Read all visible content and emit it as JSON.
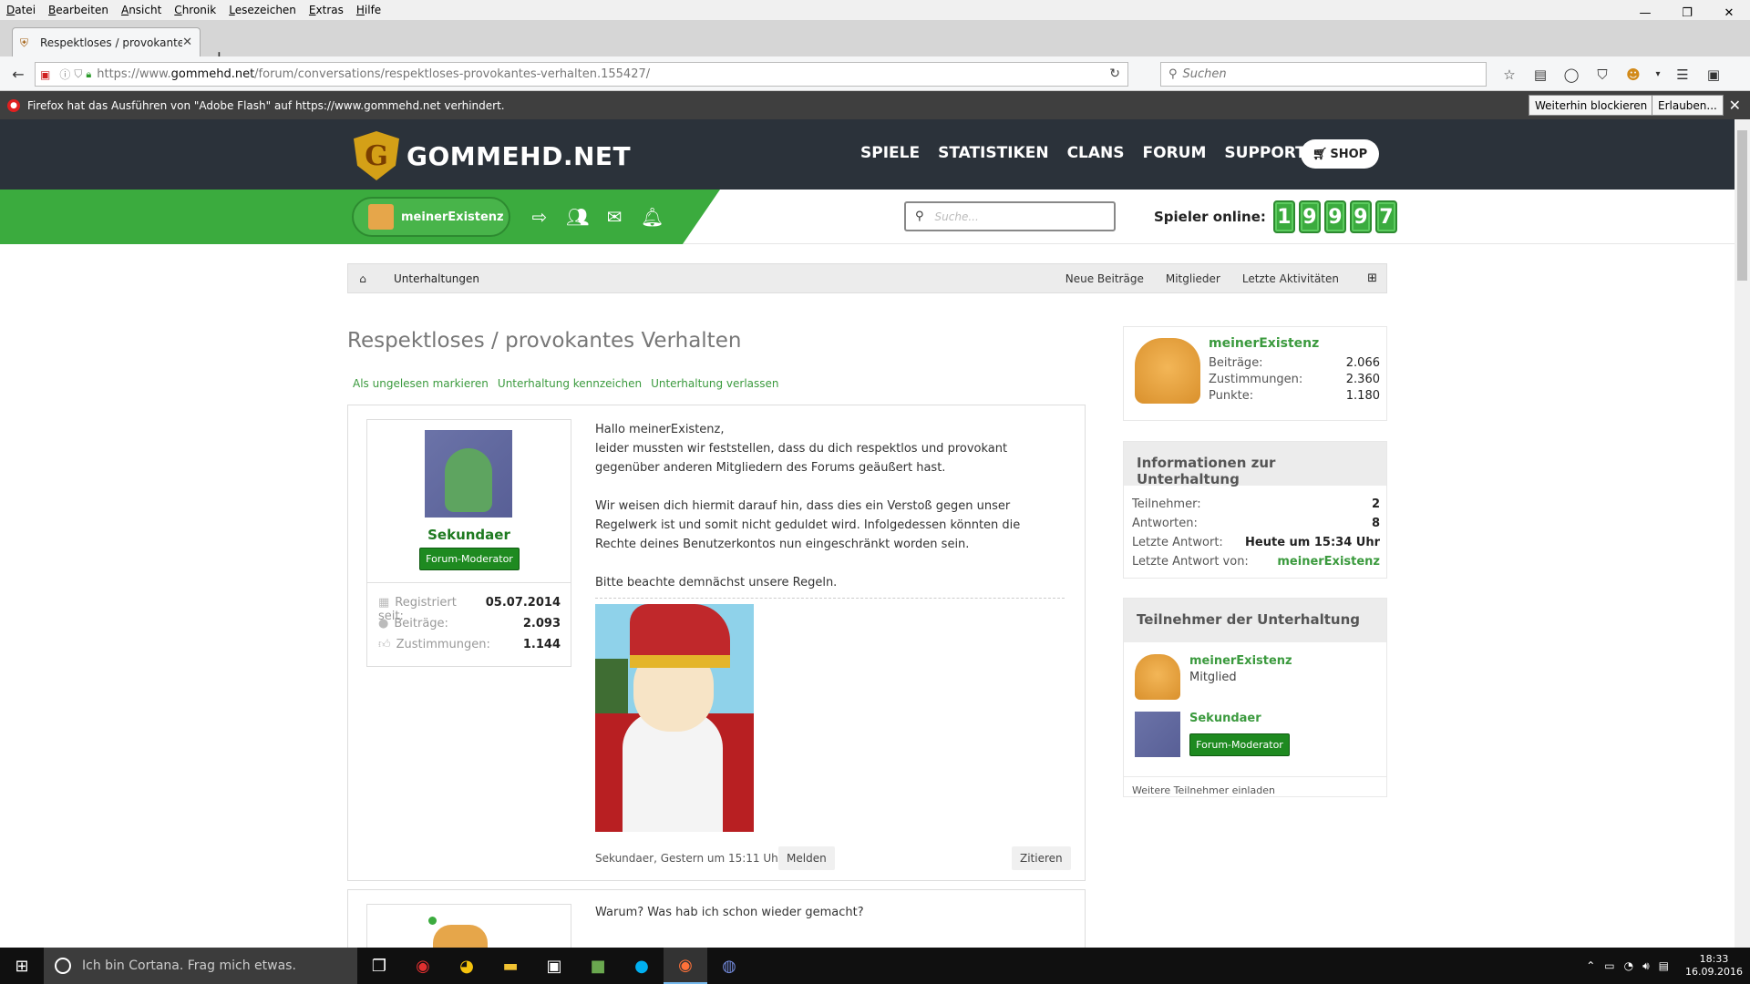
{
  "menubar": [
    "Datei",
    "Bearbeiten",
    "Ansicht",
    "Chronik",
    "Lesezeichen",
    "Extras",
    "Hilfe"
  ],
  "tab": {
    "title": "Respektloses / provokante..."
  },
  "url": {
    "prefix": "https://www.",
    "domain": "gommehd.net",
    "path": "/forum/conversations/respektloses-provokantes-verhalten.155427/"
  },
  "browser_search": {
    "placeholder": "Suchen"
  },
  "flash": {
    "message": "Firefox hat das Ausführen von \"Adobe Flash\" auf https://www.gommehd.net verhindert.",
    "block_label": "Weiterhin blockieren",
    "allow_label": "Erlauben..."
  },
  "site": {
    "logo_text": "GOMMEHD.NET",
    "nav": [
      "SPIELE",
      "STATISTIKEN",
      "CLANS",
      "FORUM",
      "SUPPORT"
    ],
    "shop_label": "SHOP",
    "username": "meinerExistenz",
    "search_placeholder": "Suche...",
    "online_label": "Spieler online:",
    "online_digits": [
      "1",
      "9",
      "9",
      "9",
      "7"
    ]
  },
  "breadcrumb": {
    "crumb": "Unterhaltungen",
    "links": [
      "Neue Beiträge",
      "Mitglieder",
      "Letzte Aktivitäten"
    ]
  },
  "page": {
    "title": "Respektloses / provokantes Verhalten",
    "actions": [
      "Als ungelesen markieren",
      "Unterhaltung kennzeichen",
      "Unterhaltung verlassen"
    ]
  },
  "message1": {
    "author": "Sekundaer",
    "role": "Forum-Moderator",
    "stats": [
      {
        "label": "Registriert seit:",
        "value": "05.07.2014"
      },
      {
        "label": "Beiträge:",
        "value": "2.093"
      },
      {
        "label": "Zustimmungen:",
        "value": "1.144"
      }
    ],
    "p1a": "Hallo meinerExistenz,",
    "p1b": "leider mussten wir feststellen, dass du dich respektlos und provokant gegenüber anderen Mitgliedern des Forums geäußert hast.",
    "p2": "Wir weisen dich hiermit darauf hin, dass dies ein Verstoß gegen unser Regelwerk ist und somit nicht geduldet wird. Infolgedessen könnten die Rechte deines Benutzerkontos nun eingeschränkt worden sein.",
    "p3": "Bitte beachte demnächst unsere Regeln.",
    "footer": "Sekundaer, Gestern um 15:11 Uhr",
    "report_label": "Melden",
    "quote_label": "Zitieren"
  },
  "message2": {
    "text": "Warum? Was hab ich schon wieder gemacht?"
  },
  "sidebar_user": {
    "name": "meinerExistenz",
    "stats": [
      {
        "label": "Beiträge:",
        "value": "2.066"
      },
      {
        "label": "Zustimmungen:",
        "value": "2.360"
      },
      {
        "label": "Punkte:",
        "value": "1.180"
      }
    ]
  },
  "info": {
    "title": "Informationen zur Unterhaltung",
    "rows": [
      {
        "label": "Teilnehmer:",
        "value": "2"
      },
      {
        "label": "Antworten:",
        "value": "8"
      },
      {
        "label": "Letzte Antwort:",
        "value": "Heute um 15:34 Uhr"
      },
      {
        "label": "Letzte Antwort von:",
        "value": "meinerExistenz"
      }
    ]
  },
  "participants": {
    "title": "Teilnehmer der Unterhaltung",
    "p1_name": "meinerExistenz",
    "p1_role": "Mitglied",
    "p2_name": "Sekundaer",
    "p2_role": "Forum-Moderator",
    "invite_label": "Weitere Teilnehmer einladen"
  },
  "taskbar": {
    "cortana": "Ich bin Cortana. Frag mich etwas.",
    "time": "18:33",
    "date": "16.09.2016"
  }
}
